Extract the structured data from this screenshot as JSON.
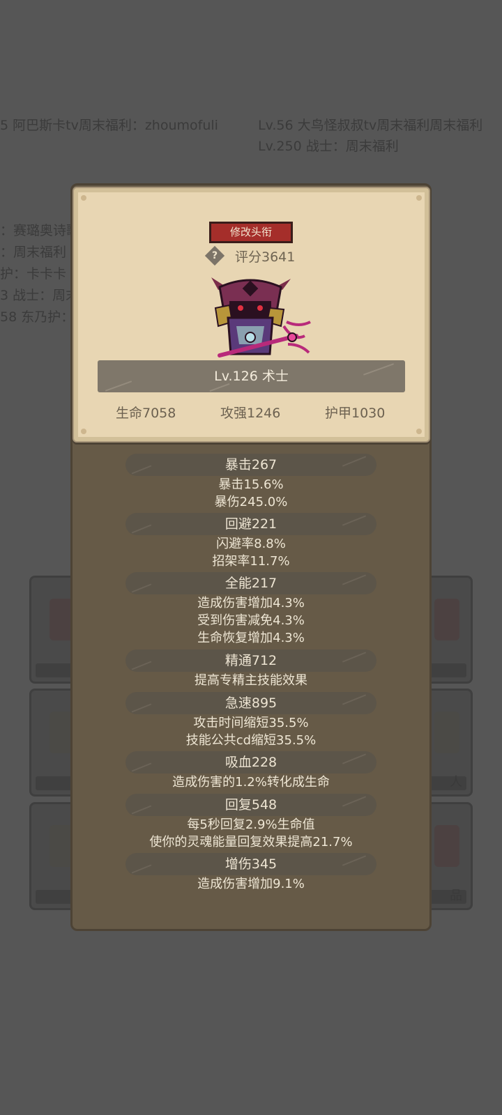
{
  "background": {
    "feed_left": "5 阿巴斯卡tv周末福利：zhoumofuli",
    "feed_right_1": "Lv.56 大鸟怪叔叔tv周末福利周末福利",
    "feed_right_2": "Lv.250 战士：周末福利",
    "side_left": [
      "：赛璐奥诗歌",
      "：周末福利",
      "护：卡卡卡",
      "3 战士：周末",
      "58 东乃护："
    ],
    "card_labels": [
      "人",
      "物",
      "品"
    ]
  },
  "profile": {
    "edit_title_button": "修改头衔",
    "help_icon": "?",
    "score": "评分3641",
    "level_class": "Lv.126 术士",
    "hp": "生命7058",
    "attack": "攻强1246",
    "armor": "护甲1030"
  },
  "stats": [
    {
      "header": "暴击267",
      "details": [
        "暴击15.6%",
        "暴伤245.0%"
      ]
    },
    {
      "header": "回避221",
      "details": [
        "闪避率8.8%",
        "招架率11.7%"
      ]
    },
    {
      "header": "全能217",
      "details": [
        "造成伤害增加4.3%",
        "受到伤害减免4.3%",
        "生命恢复增加4.3%"
      ]
    },
    {
      "header": "精通712",
      "details": [
        "提高专精主技能效果"
      ]
    },
    {
      "header": "急速895",
      "details": [
        "攻击时间缩短35.5%",
        "技能公共cd缩短35.5%"
      ]
    },
    {
      "header": "吸血228",
      "details": [
        "造成伤害的1.2%转化成生命"
      ]
    },
    {
      "header": "回复548",
      "details": [
        "每5秒回复2.9%生命值",
        "使你的灵魂能量回复效果提高21.7%"
      ]
    },
    {
      "header": "增伤345",
      "details": [
        "造成伤害增加9.1%"
      ]
    }
  ],
  "colors": {
    "panel": "#665a47",
    "card": "#e8d6b3",
    "button_red": "#a52e2a",
    "level_bar": "#7f776a"
  }
}
